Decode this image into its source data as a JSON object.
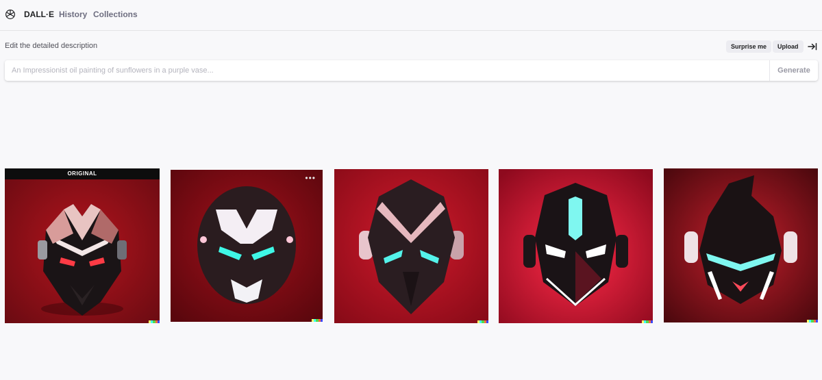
{
  "header": {
    "brand": "DALL·E",
    "nav": [
      {
        "label": "History"
      },
      {
        "label": "Collections"
      }
    ]
  },
  "editor": {
    "label": "Edit the detailed description",
    "surprise_label": "Surprise me",
    "upload_label": "Upload",
    "prompt_value": "",
    "prompt_placeholder": "An Impressionist oil painting of sunflowers in a purple vase...",
    "generate_label": "Generate"
  },
  "gallery": {
    "original_label": "ORIGINAL",
    "more_label": "•••",
    "images": [
      {
        "kind": "original",
        "bg": "#8d0f16",
        "eye": "#ff3b45"
      },
      {
        "kind": "variation",
        "bg": "#7d0a12",
        "eye": "#3ff7e6"
      },
      {
        "kind": "variation",
        "bg": "#b30f22",
        "eye": "#54f2ea"
      },
      {
        "kind": "variation",
        "bg": "#c0102a",
        "eye": "#ffffff"
      },
      {
        "kind": "variation",
        "bg": "#7e1119",
        "eye": "#7ff7f0"
      }
    ],
    "signature_colors": [
      "#ffff66",
      "#42ffff",
      "#51da4c",
      "#ff6e3c",
      "#3c46ff"
    ]
  },
  "icons": {
    "logo": "openai-logo-icon",
    "collapse": "collapse-right-icon"
  }
}
